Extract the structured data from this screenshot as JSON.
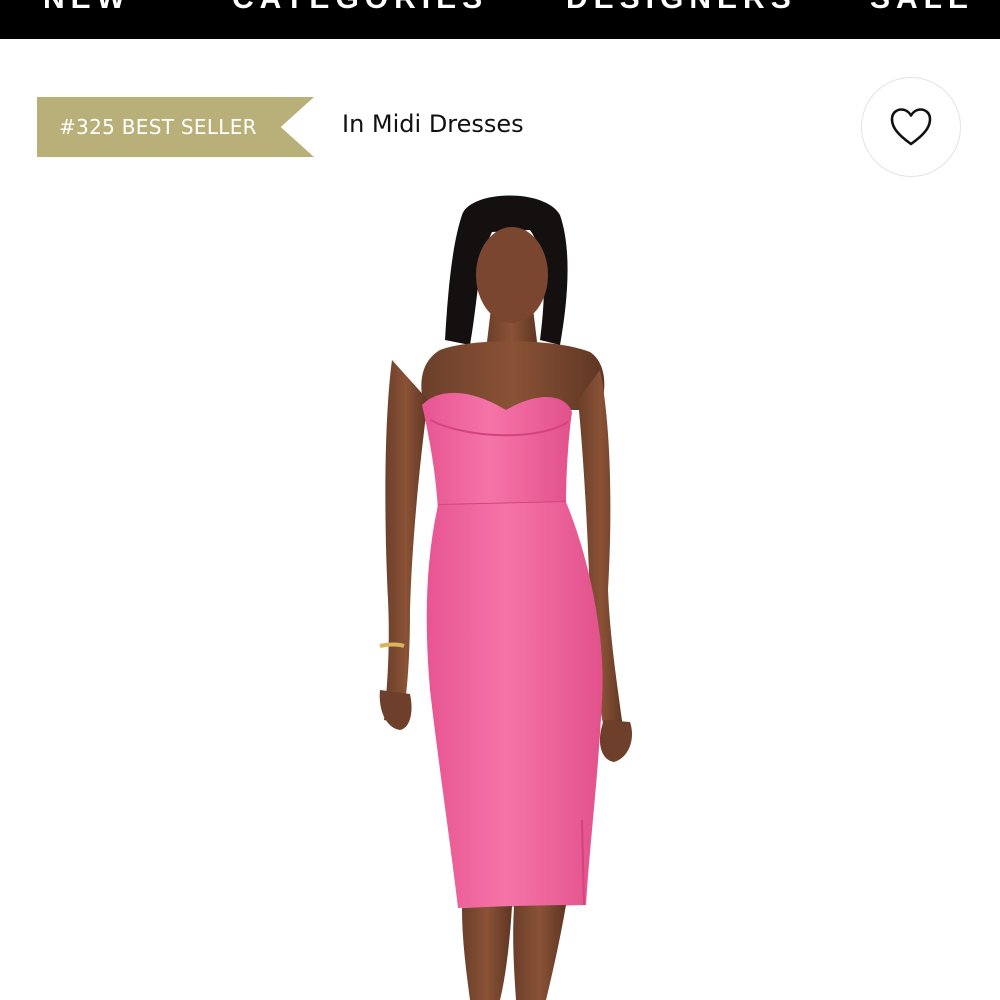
{
  "nav": {
    "items": [
      {
        "label": "NEW"
      },
      {
        "label": "CATEGORIES"
      },
      {
        "label": "DESIGNERS"
      },
      {
        "label": "SALE"
      }
    ]
  },
  "badge": {
    "text": "#325 BEST SELLER",
    "color": "#b8b078"
  },
  "category": {
    "text": "In Midi Dresses"
  },
  "favorite": {
    "icon": "heart-outline-icon"
  },
  "product": {
    "image": "model-in-pink-strapless-midi-dress",
    "dress_color": "#f0699f"
  }
}
